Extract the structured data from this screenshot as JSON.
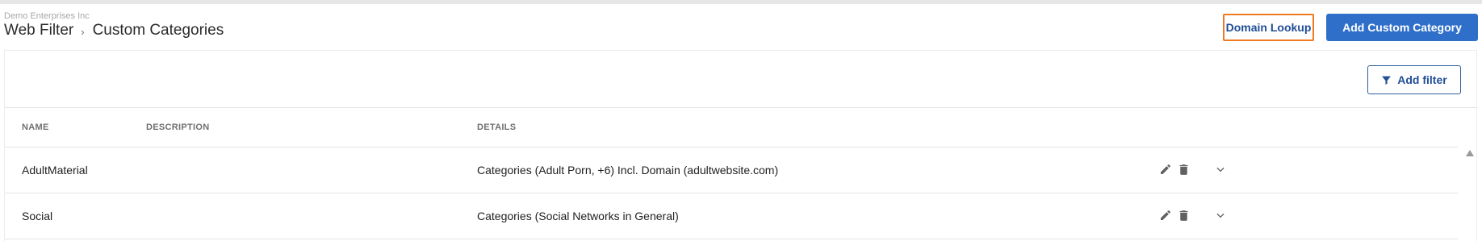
{
  "header": {
    "org_name": "Demo Enterprises Inc",
    "breadcrumb": {
      "parent": "Web Filter",
      "separator": "›",
      "current": "Custom Categories"
    },
    "domain_lookup_label": "Domain Lookup",
    "add_category_label": "Add Custom Category"
  },
  "toolbar": {
    "add_filter_label": "Add filter"
  },
  "table": {
    "columns": [
      "NAME",
      "DESCRIPTION",
      "DETAILS"
    ],
    "rows": [
      {
        "name": "AdultMaterial",
        "description": "",
        "details": "Categories (Adult Porn, +6) Incl. Domain (adultwebsite.com)"
      },
      {
        "name": "Social",
        "description": "",
        "details": "Categories (Social Networks in General)"
      }
    ]
  },
  "colors": {
    "accent": "#2f6fca",
    "highlight_border": "#f07a22",
    "link": "#1f4e96"
  },
  "icons": [
    "funnel-icon",
    "pencil-icon",
    "trash-icon",
    "chevron-down-icon",
    "scroll-up-arrow-icon"
  ]
}
